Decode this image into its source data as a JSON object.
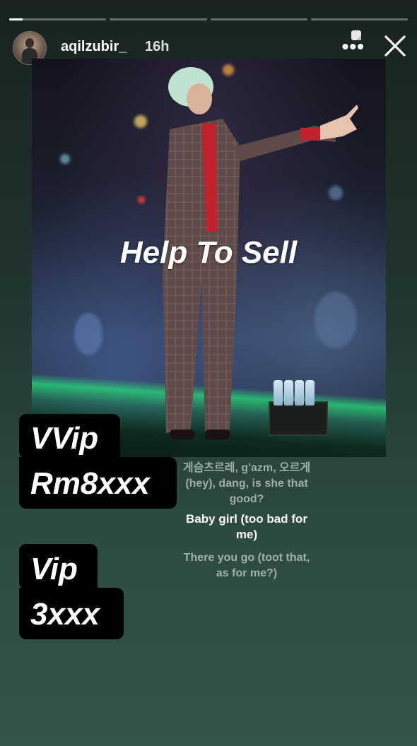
{
  "story": {
    "progress": [
      1,
      0,
      0,
      0
    ],
    "current_fill": 0.14
  },
  "header": {
    "username": "aqilzubir_",
    "time": "16h",
    "more_icon": "more-dots-icon",
    "close_icon": "close-icon"
  },
  "overlay": {
    "help_text": "Help To Sell"
  },
  "labels": {
    "vvip_title": "VVip",
    "vvip_price": "Rm8xxx",
    "vip_title": "Vip",
    "vip_price": "3xxx"
  },
  "lyrics": {
    "line1": "게슴츠르레, g'azm, 오르게 (hey), dang, is she that good?",
    "line2": "Baby girl (too bad for me)",
    "line3": "There you go (toot that, as for me?)"
  },
  "colors": {
    "background_top": "#18231f",
    "background_bottom": "#34554b",
    "label_bg": "#000000",
    "stage_green": "#28dc78"
  }
}
